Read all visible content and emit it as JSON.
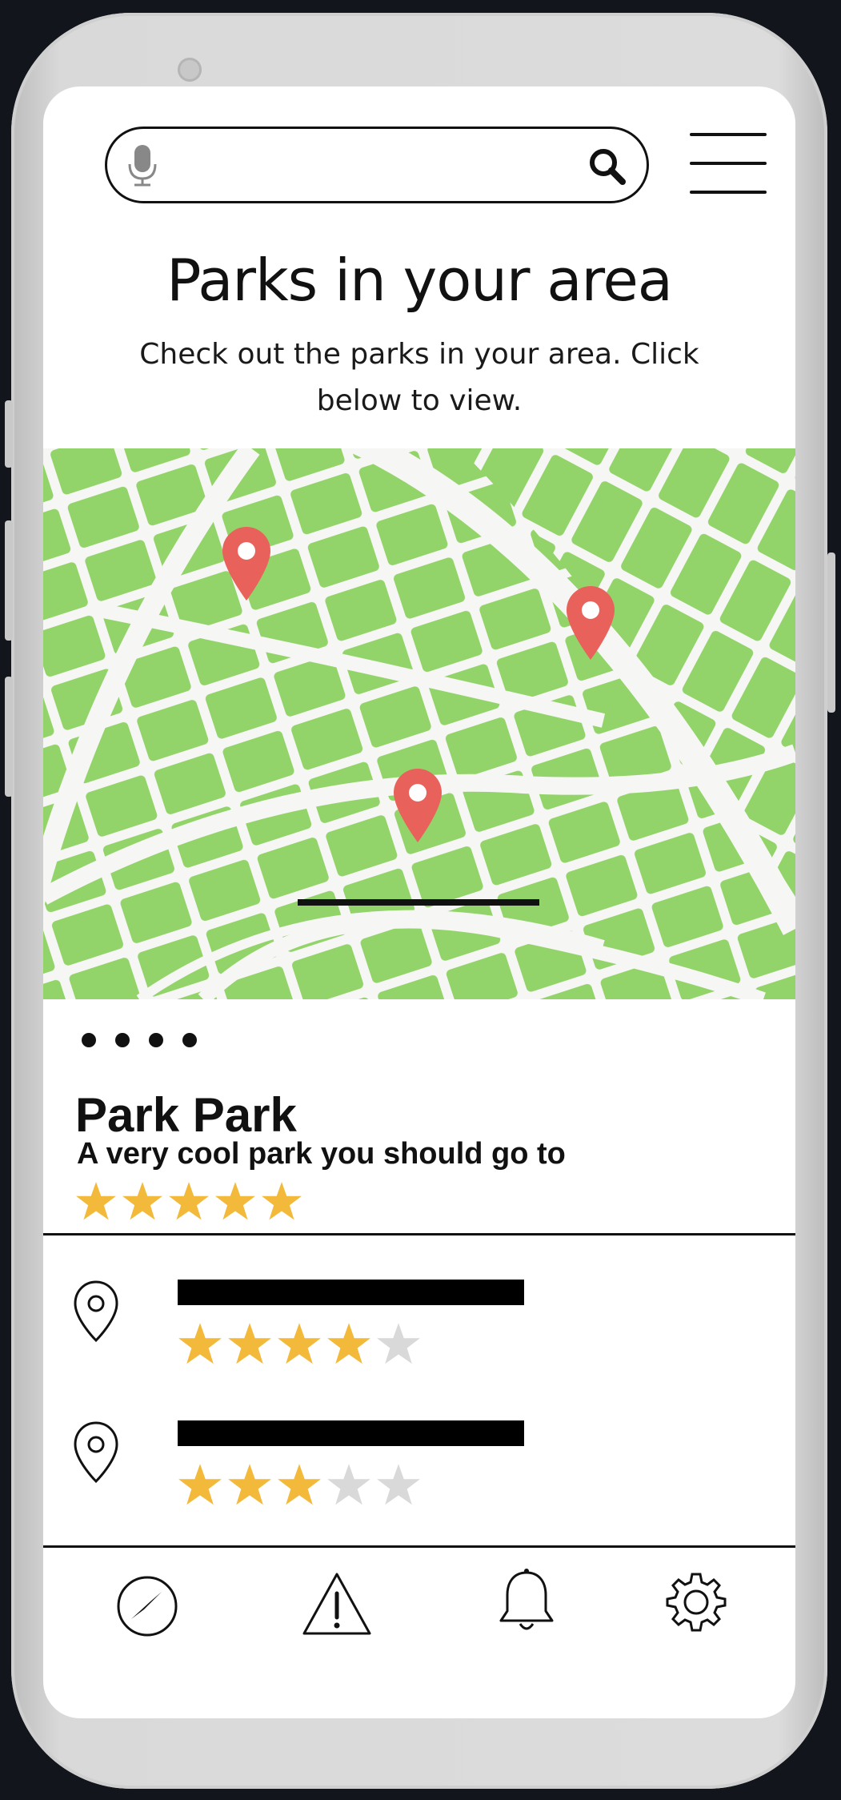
{
  "search": {
    "placeholder": "",
    "value": ""
  },
  "header": {
    "title": "Parks in your area",
    "subtitle": "Check out the parks in your area. Click below to view."
  },
  "carousel": {
    "dots": 4
  },
  "featured": {
    "name": "Park Park",
    "description": "A very cool park you should go to",
    "rating": 5
  },
  "list": [
    {
      "rating": 4
    },
    {
      "rating": 3
    }
  ],
  "icons": {
    "mic": "microphone-icon",
    "search": "search-icon",
    "menu": "menu-icon",
    "pin": "map-pin-icon",
    "nav": [
      "compass-icon",
      "warning-icon",
      "bell-icon",
      "gear-icon"
    ]
  },
  "colors": {
    "map_green": "#93d46a",
    "pin_red": "#e8615b",
    "star_gold": "#f2b93b",
    "star_gray": "#d9d9d9"
  }
}
